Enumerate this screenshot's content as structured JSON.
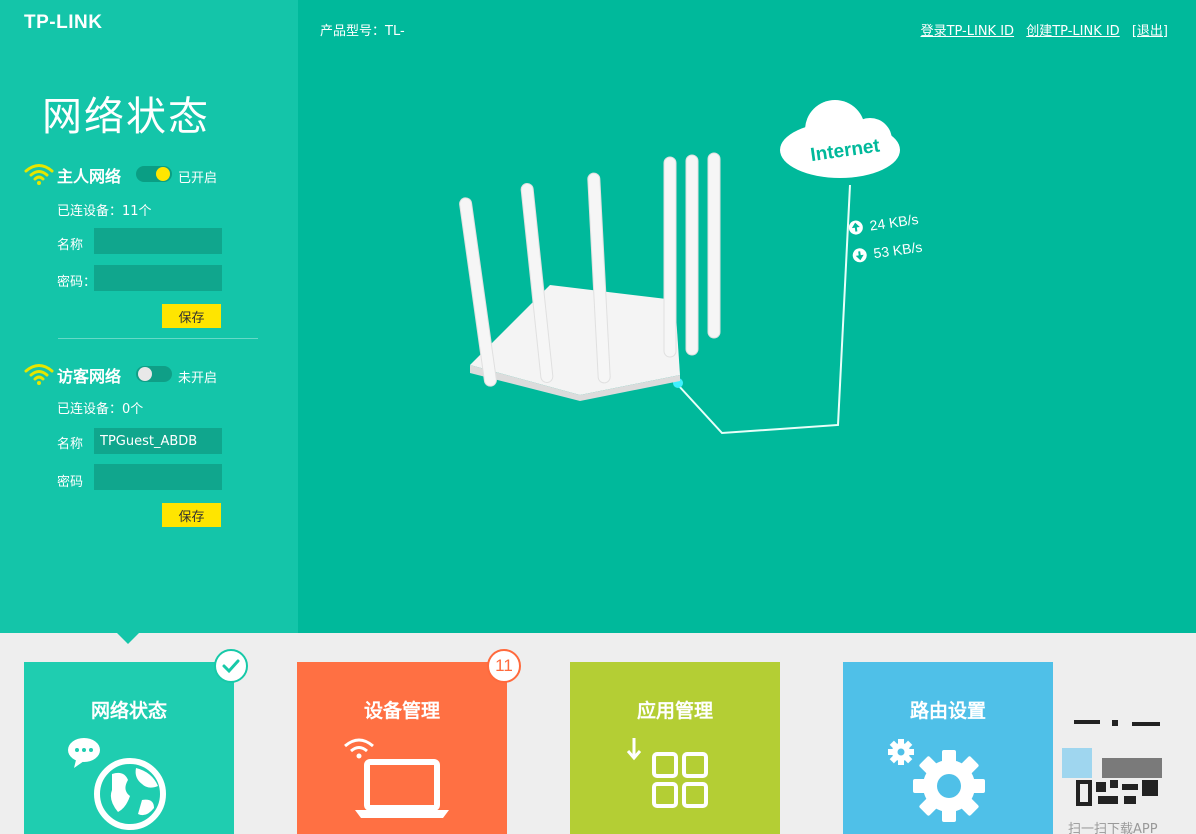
{
  "header": {
    "logo": "TP-LINK",
    "product_model": "产品型号：TL-",
    "links": [
      "登录TP-LINK ID",
      "创建TP-LINK ID",
      "[退出]"
    ]
  },
  "sidebar": {
    "title": "网络状态",
    "host_network": {
      "title": "主人网络",
      "toggle_state": "已开启",
      "connected": "已连设备：11个",
      "name_label": "名称",
      "name_value": "",
      "password_label": "密码：",
      "password_value": "",
      "save_label": "保存"
    },
    "guest_network": {
      "title": "访客网络",
      "toggle_state": "未开启",
      "connected": "已连设备：0个",
      "name_label": "名称",
      "name_value": "TPGuest_ABDB",
      "password_label": "密码",
      "password_value": "",
      "save_label": "保存"
    }
  },
  "illustration": {
    "cloud_label": "Internet",
    "upload_speed": "24 KB/s",
    "download_speed": "53 KB/s"
  },
  "tiles": [
    {
      "label": "网络状态",
      "color": "#1fcdb0",
      "icon": "globe-icon",
      "badge": "check"
    },
    {
      "label": "设备管理",
      "color": "#ff7043",
      "icon": "laptop-wifi-icon",
      "badge": "11"
    },
    {
      "label": "应用管理",
      "color": "#b4ce34",
      "icon": "apps-grid-icon"
    },
    {
      "label": "路由设置",
      "color": "#4fc0e8",
      "icon": "gear-icon"
    }
  ],
  "qr_caption": "扫一扫下载APP",
  "colors": {
    "main_bg": "#00b99b",
    "sidebar_bg": "#14c5a9",
    "accent_yellow": "#ffe500"
  }
}
